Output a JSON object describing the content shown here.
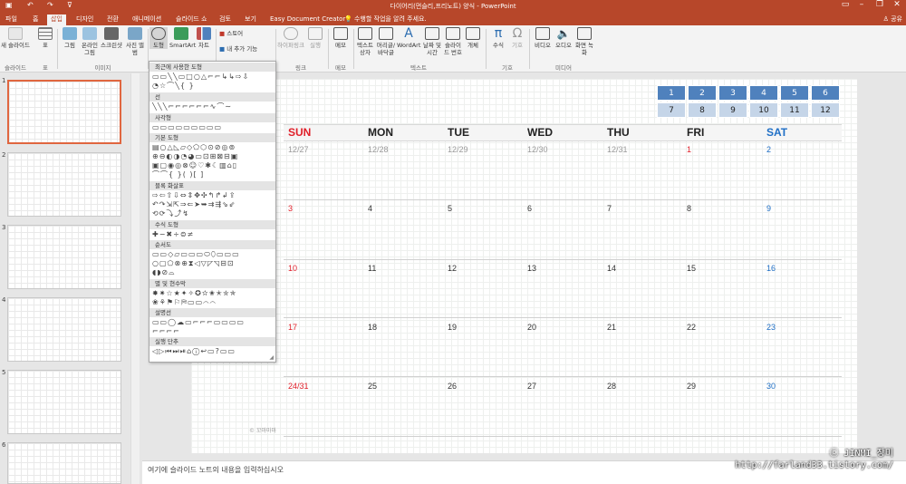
{
  "window": {
    "title": "다이어리(먼슬리,프리노트) 양식 - PowerPoint",
    "share_label": "공유",
    "quick_access": [
      "save",
      "undo",
      "redo",
      "customize"
    ]
  },
  "tabs": [
    {
      "label": "파일",
      "active": false
    },
    {
      "label": "홈",
      "active": false
    },
    {
      "label": "삽입",
      "active": true
    },
    {
      "label": "디자인",
      "active": false
    },
    {
      "label": "전환",
      "active": false
    },
    {
      "label": "애니메이션",
      "active": false
    },
    {
      "label": "슬라이드 쇼",
      "active": false
    },
    {
      "label": "검토",
      "active": false
    },
    {
      "label": "보기",
      "active": false
    },
    {
      "label": "Easy Document Creator",
      "active": false
    }
  ],
  "tell_me": "수행할 작업을 알려 주세요.",
  "ribbon": {
    "buttons": [
      {
        "label": "새 슬라이드",
        "icon": "new-slide-icon"
      },
      {
        "label": "표",
        "icon": "table-icon"
      },
      {
        "label": "그림",
        "icon": "picture-icon"
      },
      {
        "label": "온라인 그림",
        "icon": "online-picture-icon"
      },
      {
        "label": "스크린샷",
        "icon": "screenshot-icon"
      },
      {
        "label": "사진 앨범",
        "icon": "photo-album-icon"
      },
      {
        "label": "도형",
        "icon": "shapes-icon"
      },
      {
        "label": "SmartArt",
        "icon": "smartart-icon"
      },
      {
        "label": "차트",
        "icon": "chart-icon"
      },
      {
        "label": "스토어",
        "icon": "store-icon"
      },
      {
        "label": "내 추가 기능",
        "icon": "addins-icon"
      },
      {
        "label": "하이퍼링크",
        "icon": "hyperlink-icon"
      },
      {
        "label": "실행",
        "icon": "action-icon"
      },
      {
        "label": "메모",
        "icon": "comment-icon"
      },
      {
        "label": "텍스트 상자",
        "icon": "textbox-icon"
      },
      {
        "label": "머리글/바닥글",
        "icon": "header-footer-icon"
      },
      {
        "label": "WordArt",
        "icon": "wordart-icon"
      },
      {
        "label": "날짜 및 시간",
        "icon": "datetime-icon"
      },
      {
        "label": "슬라이드 번호",
        "icon": "slide-number-icon"
      },
      {
        "label": "개체",
        "icon": "object-icon"
      },
      {
        "label": "수식",
        "icon": "equation-icon"
      },
      {
        "label": "기호",
        "icon": "symbol-icon"
      },
      {
        "label": "비디오",
        "icon": "video-icon"
      },
      {
        "label": "오디오",
        "icon": "audio-icon"
      },
      {
        "label": "화면 녹화",
        "icon": "screen-record-icon"
      }
    ],
    "groups": [
      "슬라이드",
      "표",
      "이미지",
      "링크",
      "메모",
      "텍스트",
      "기호",
      "미디어"
    ]
  },
  "shapes_menu": {
    "sections": [
      "최근에 사용한 도형",
      "선",
      "사각형",
      "기본 도형",
      "블록 화살표",
      "수식 도형",
      "순서도",
      "별 및 현수막",
      "설명선",
      "실행 단추"
    ]
  },
  "slides": [
    1,
    2,
    3,
    4,
    5,
    6
  ],
  "calendar": {
    "months_top": [
      "1",
      "2",
      "3",
      "4",
      "5",
      "6"
    ],
    "months_bottom": [
      "7",
      "8",
      "9",
      "10",
      "11",
      "12"
    ],
    "days": [
      "SUN",
      "MON",
      "TUE",
      "WED",
      "THU",
      "FRI",
      "SAT"
    ],
    "weeks": [
      [
        "12/27",
        "12/28",
        "12/29",
        "12/30",
        "12/31",
        "1",
        "2"
      ],
      [
        "3",
        "4",
        "5",
        "6",
        "7",
        "8",
        "9"
      ],
      [
        "10",
        "11",
        "12",
        "13",
        "14",
        "15",
        "16"
      ],
      [
        "17",
        "18",
        "19",
        "20",
        "21",
        "22",
        "23"
      ],
      [
        "24/31",
        "25",
        "26",
        "27",
        "28",
        "29",
        "30"
      ]
    ],
    "watermark": "© 꼬마마마",
    "colors": {
      "sun": "#e0202a",
      "sat": "#1f6fc6",
      "prev": "#999999",
      "month_box": "#4f81bd"
    }
  },
  "notes_placeholder": "여기에 슬라이드 노트의 내용을 입력하십시오",
  "credit": {
    "line1": "ⓒ JINMI_장미",
    "line2": "http://farland33.tistory.com/"
  }
}
